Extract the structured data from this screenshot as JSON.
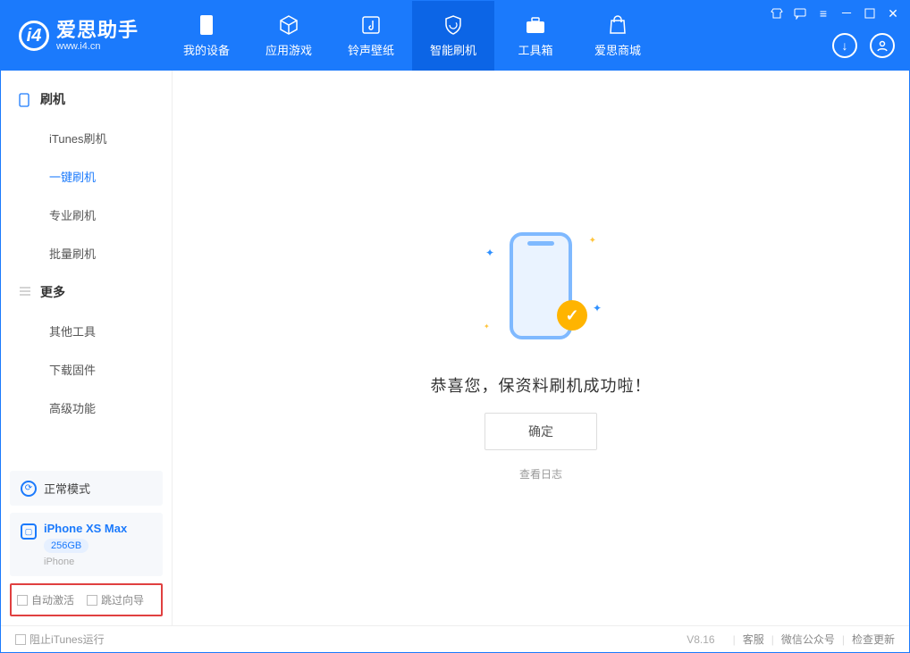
{
  "brand": {
    "name": "爱思助手",
    "url": "www.i4.cn"
  },
  "tabs": [
    {
      "label": "我的设备"
    },
    {
      "label": "应用游戏"
    },
    {
      "label": "铃声壁纸"
    },
    {
      "label": "智能刷机"
    },
    {
      "label": "工具箱"
    },
    {
      "label": "爱思商城"
    }
  ],
  "sidebar": {
    "group1": {
      "title": "刷机",
      "items": [
        "iTunes刷机",
        "一键刷机",
        "专业刷机",
        "批量刷机"
      ]
    },
    "group2": {
      "title": "更多",
      "items": [
        "其他工具",
        "下载固件",
        "高级功能"
      ]
    }
  },
  "mode": {
    "label": "正常模式"
  },
  "device": {
    "name": "iPhone XS Max",
    "storage": "256GB",
    "type": "iPhone"
  },
  "options": {
    "auto_activate": "自动激活",
    "skip_wizard": "跳过向导"
  },
  "main": {
    "success_text": "恭喜您，保资料刷机成功啦！",
    "ok_button": "确定",
    "view_log": "查看日志"
  },
  "footer": {
    "block_itunes": "阻止iTunes运行",
    "version": "V8.16",
    "support": "客服",
    "wechat": "微信公众号",
    "check_update": "检查更新"
  }
}
